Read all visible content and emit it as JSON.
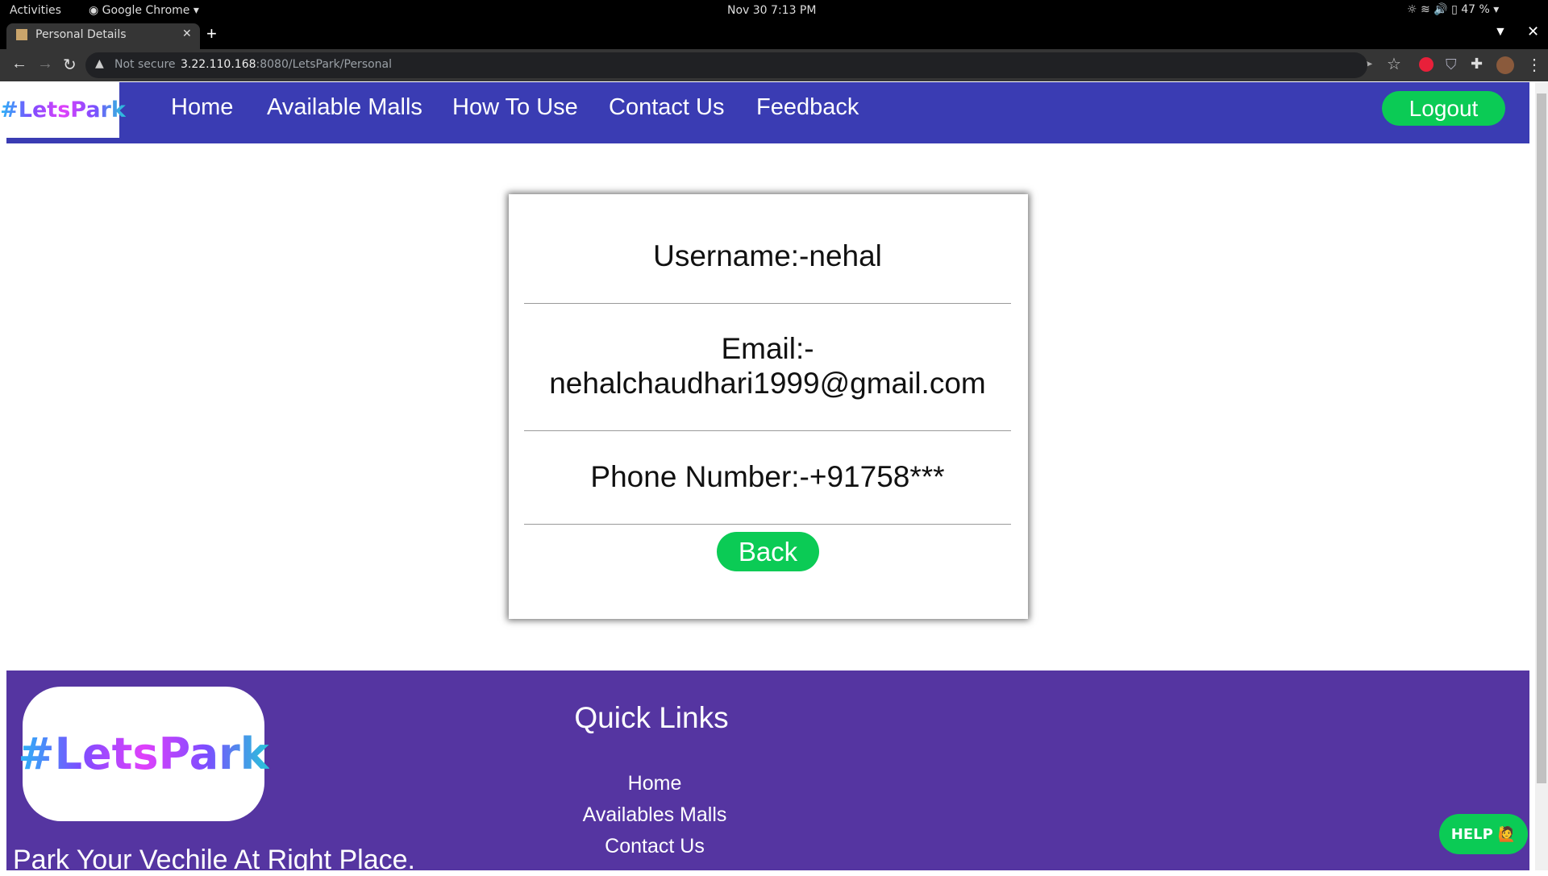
{
  "system": {
    "activities": "Activities",
    "app": "Google Chrome",
    "datetime": "Nov 30  7:13 PM",
    "battery": "47 %"
  },
  "browser": {
    "tab_title": "Personal Details",
    "security": "Not secure",
    "url_host": "3.22.110.168",
    "url_path": ":8080/LetsPark/Personal"
  },
  "nav": {
    "logo": "#LetsPark",
    "items": [
      "Home",
      "Available Malls",
      "How To Use",
      "Contact Us",
      "Feedback"
    ],
    "logout": "Logout"
  },
  "profile": {
    "username": "Username:-nehal",
    "email_label": "Email:-",
    "email": "nehalchaudhari1999@gmail.com",
    "phone": "Phone Number:-+91758***",
    "back": "Back"
  },
  "footer": {
    "logo": "#LetsPark",
    "quick_links_title": "Quick Links",
    "links": [
      "Home",
      "Availables Malls",
      "Contact Us"
    ],
    "tagline": "Park Your Vechile At Right Place.",
    "help": "HELP"
  },
  "colors": {
    "nav": "#3a3cb3",
    "footer": "#5535a1",
    "button": "#0bcb55"
  }
}
